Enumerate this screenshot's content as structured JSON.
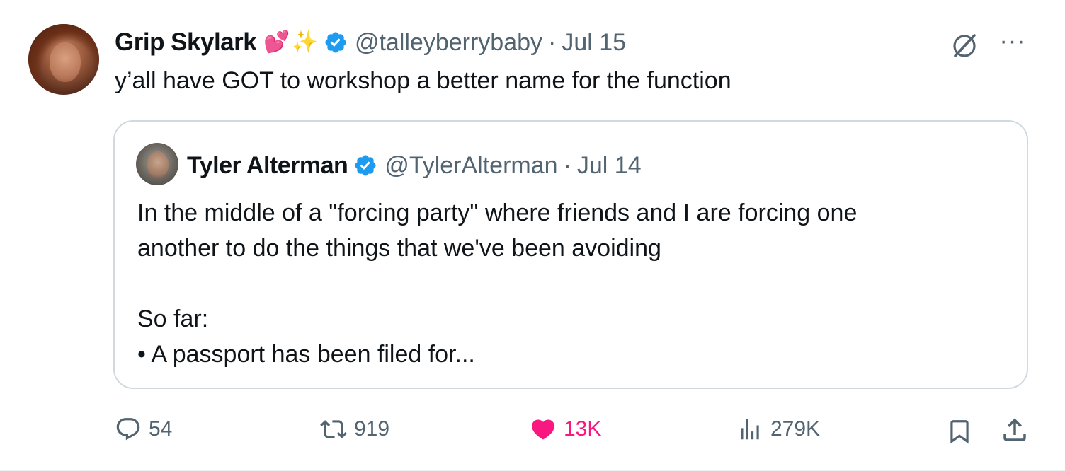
{
  "post": {
    "author_name": "Grip Skylark",
    "emoji_1": "💕",
    "emoji_2": "✨",
    "handle": "@talleyberrybaby",
    "separator": "·",
    "date": "Jul 15",
    "text": "y’all have GOT to workshop a better name for the function"
  },
  "quote": {
    "author_name": "Tyler Alterman",
    "handle": "@TylerAlterman",
    "separator": "·",
    "date": "Jul 14",
    "lines": [
      "In the middle of a \"forcing party\" where friends and I are forcing one",
      "another to do the things that we've been avoiding",
      "",
      "So far:",
      "• A passport has been filed for..."
    ]
  },
  "more_label": "···",
  "actions": {
    "replies": "54",
    "reposts": "919",
    "likes": "13K",
    "views": "279K"
  },
  "colors": {
    "text": "#0f1419",
    "secondary": "#536471",
    "verified": "#1d9bf0",
    "like": "#f91880",
    "border": "#cfd9de"
  },
  "icons": [
    "grok-icon",
    "more-icon",
    "verified-icon",
    "reply-icon",
    "retweet-icon",
    "heart-icon",
    "views-icon",
    "bookmark-icon",
    "share-icon"
  ]
}
